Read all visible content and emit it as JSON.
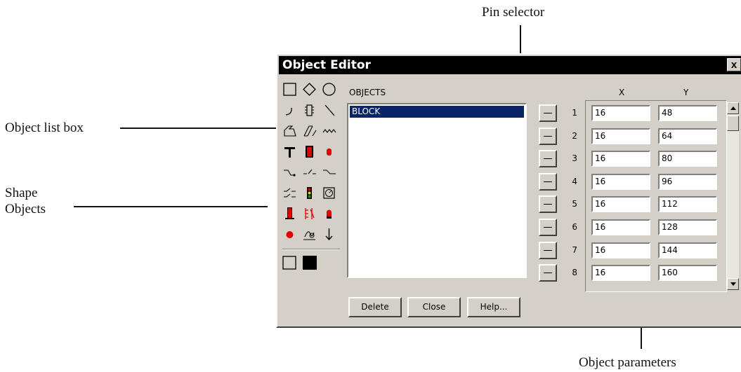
{
  "callouts": {
    "pin_selector": "Pin selector",
    "object_list_box": "Object list box",
    "shape_objects_line1": "Shape",
    "shape_objects_line2": "Objects",
    "object_parameters": "Object parameters"
  },
  "window": {
    "title": "Object Editor",
    "close_glyph": "x"
  },
  "objects_label": "OBJECTS",
  "objects_list": [
    "BLOCK"
  ],
  "buttons": {
    "delete": "Delete",
    "close": "Close",
    "help": "Help..."
  },
  "params": {
    "x_header": "X",
    "y_header": "Y",
    "rows": [
      {
        "n": "1",
        "x": "16",
        "y": "48"
      },
      {
        "n": "2",
        "x": "16",
        "y": "64"
      },
      {
        "n": "3",
        "x": "16",
        "y": "80"
      },
      {
        "n": "4",
        "x": "16",
        "y": "96"
      },
      {
        "n": "5",
        "x": "16",
        "y": "112"
      },
      {
        "n": "6",
        "x": "16",
        "y": "128"
      },
      {
        "n": "7",
        "x": "16",
        "y": "144"
      },
      {
        "n": "8",
        "x": "16",
        "y": "160"
      }
    ]
  },
  "tools": [
    "rectangle-icon",
    "diamond-icon",
    "circle-icon",
    "arc-icon",
    "chip-icon",
    "diagonal-line-icon",
    "polygon-icon",
    "double-polyline-icon",
    "zigzag-icon",
    "text-tool-icon",
    "red-block-icon",
    "red-led-icon",
    "switch-open-icon",
    "switch-break-icon",
    "switch-closed-icon",
    "double-switch-icon",
    "traffic-light-icon",
    "gauge-icon",
    "red-bar-icon",
    "relay-icon",
    "red-bulb-icon",
    "red-dot-icon",
    "motor-icon",
    "arrow-down-icon"
  ],
  "colors": {
    "dialog_bg": "#d4d0c8",
    "titlebar_bg": "#000000",
    "selection_bg": "#0a246a",
    "accent_red": "#e00000"
  }
}
